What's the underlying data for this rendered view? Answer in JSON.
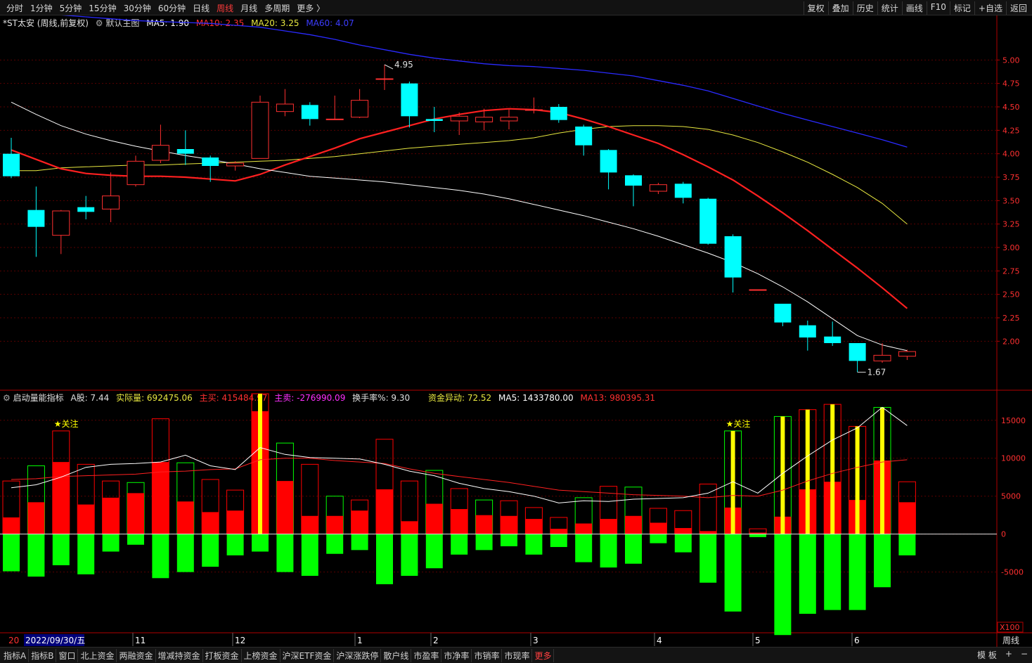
{
  "toolbar": {
    "periods": [
      "分时",
      "1分钟",
      "5分钟",
      "15分钟",
      "30分钟",
      "60分钟",
      "日线",
      "周线",
      "月线",
      "多周期",
      "更多 〉"
    ],
    "active_period": "周线",
    "tools": [
      "复权",
      "叠加",
      "历史",
      "统计",
      "画线",
      "F10",
      "标记",
      "+自选",
      "返回"
    ]
  },
  "main_header": {
    "stock": "*ST太安 (周线,前复权)",
    "template": "默认主图",
    "ma5": "MA5: 1.90",
    "ma10": "MA10: 2.35",
    "ma20": "MA20: 3.25",
    "ma60": "MA60: 4.07"
  },
  "sub_header": {
    "name": "启动量能指标",
    "a": "A股: 7.44",
    "actual": "实际量: 692475.06",
    "buy": "主买: 415484.97",
    "sell": "主卖: -276990.09",
    "turnover": "换手率%: 9.30",
    "fund": "资金异动: 72.52",
    "ma5": "MA5: 1433780.00",
    "ma13": "MA13: 980395.31"
  },
  "colors": {
    "up": "#ff3030",
    "down": "#00ffff",
    "ma5": "#ffffff",
    "ma10": "#ff2020",
    "ma20": "#e8e840",
    "ma60": "#2a2aff",
    "buy": "#ff0000",
    "sell": "#00ff00",
    "hot": "#ffff00",
    "frame": "#b00000"
  },
  "annotations": {
    "high": "4.95",
    "low": "1.67",
    "star1": "★关注",
    "star2": "★关注",
    "multiplier": "X100"
  },
  "x_axis_labels": [
    "2022/09/30/五",
    "11",
    "12",
    "1",
    "2",
    "3",
    "4",
    "5",
    "6"
  ],
  "x_axis_lead": "20",
  "period_label": "周线",
  "chart_data": [
    {
      "type": "candlestick",
      "title": "*ST太安 (周线,前复权)",
      "ylim": [
        1.5,
        5.4
      ],
      "y_ticks": [
        "5.00",
        "4.75",
        "4.50",
        "4.25",
        "4.00",
        "3.75",
        "3.50",
        "3.25",
        "3.00",
        "2.75",
        "2.50",
        "2.25",
        "2.00"
      ],
      "candles": [
        {
          "o": 4.0,
          "c": 3.76,
          "h": 4.17,
          "l": 3.74
        },
        {
          "o": 3.4,
          "c": 3.22,
          "h": 3.65,
          "l": 2.9
        },
        {
          "o": 3.13,
          "c": 3.39,
          "h": 3.4,
          "l": 2.93
        },
        {
          "o": 3.43,
          "c": 3.38,
          "h": 3.55,
          "l": 3.3
        },
        {
          "o": 3.41,
          "c": 3.55,
          "h": 3.8,
          "l": 3.27
        },
        {
          "o": 3.67,
          "c": 3.92,
          "h": 3.98,
          "l": 3.65
        },
        {
          "o": 3.93,
          "c": 4.09,
          "h": 4.31,
          "l": 3.9
        },
        {
          "o": 4.05,
          "c": 4.0,
          "h": 4.25,
          "l": 3.88
        },
        {
          "o": 3.96,
          "c": 3.87,
          "h": 3.98,
          "l": 3.7
        },
        {
          "o": 3.87,
          "c": 3.9,
          "h": 3.92,
          "l": 3.82
        },
        {
          "o": 3.95,
          "c": 4.55,
          "h": 4.62,
          "l": 3.95
        },
        {
          "o": 4.45,
          "c": 4.53,
          "h": 4.69,
          "l": 4.4
        },
        {
          "o": 4.52,
          "c": 4.37,
          "h": 4.55,
          "l": 4.3
        },
        {
          "o": 4.37,
          "c": 4.37,
          "h": 4.62,
          "l": 4.37
        },
        {
          "o": 4.39,
          "c": 4.57,
          "h": 4.69,
          "l": 4.38
        },
        {
          "o": 4.8,
          "c": 4.8,
          "h": 4.95,
          "l": 4.68
        },
        {
          "o": 4.75,
          "c": 4.4,
          "h": 4.77,
          "l": 4.28
        },
        {
          "o": 4.37,
          "c": 4.35,
          "h": 4.5,
          "l": 4.23
        },
        {
          "o": 4.35,
          "c": 4.4,
          "h": 4.44,
          "l": 4.2
        },
        {
          "o": 4.34,
          "c": 4.39,
          "h": 4.48,
          "l": 4.25
        },
        {
          "o": 4.35,
          "c": 4.39,
          "h": 4.47,
          "l": 4.26
        },
        {
          "o": 4.47,
          "c": 4.47,
          "h": 4.6,
          "l": 4.43
        },
        {
          "o": 4.5,
          "c": 4.36,
          "h": 4.53,
          "l": 4.33
        },
        {
          "o": 4.29,
          "c": 4.09,
          "h": 4.31,
          "l": 3.98
        },
        {
          "o": 4.04,
          "c": 3.8,
          "h": 4.05,
          "l": 3.62
        },
        {
          "o": 3.77,
          "c": 3.66,
          "h": 3.78,
          "l": 3.44
        },
        {
          "o": 3.6,
          "c": 3.67,
          "h": 3.69,
          "l": 3.57
        },
        {
          "o": 3.68,
          "c": 3.53,
          "h": 3.7,
          "l": 3.47
        },
        {
          "o": 3.52,
          "c": 3.04,
          "h": 3.53,
          "l": 3.03
        },
        {
          "o": 3.12,
          "c": 2.68,
          "h": 3.14,
          "l": 2.52
        },
        {
          "o": 2.55,
          "c": 2.55,
          "h": 2.55,
          "l": 2.55
        },
        {
          "o": 2.4,
          "c": 2.2,
          "h": 2.4,
          "l": 2.16
        },
        {
          "o": 2.17,
          "c": 2.04,
          "h": 2.22,
          "l": 1.9
        },
        {
          "o": 2.05,
          "c": 1.98,
          "h": 2.21,
          "l": 1.95
        },
        {
          "o": 1.98,
          "c": 1.79,
          "h": 1.98,
          "l": 1.67
        },
        {
          "o": 1.79,
          "c": 1.85,
          "h": 1.98,
          "l": 1.77
        },
        {
          "o": 1.84,
          "c": 1.89,
          "h": 1.91,
          "l": 1.8
        }
      ],
      "ma5": [
        4.55,
        4.42,
        4.3,
        4.21,
        4.14,
        4.08,
        4.03,
        3.98,
        3.94,
        3.89,
        3.84,
        3.8,
        3.76,
        3.74,
        3.72,
        3.7,
        3.67,
        3.64,
        3.61,
        3.57,
        3.52,
        3.46,
        3.4,
        3.34,
        3.27,
        3.2,
        3.12,
        3.03,
        2.94,
        2.84,
        2.72,
        2.58,
        2.42,
        2.24,
        2.06,
        1.96,
        1.9
      ],
      "ma10": [
        4.04,
        3.94,
        3.84,
        3.79,
        3.77,
        3.76,
        3.76,
        3.75,
        3.73,
        3.71,
        3.78,
        3.88,
        3.97,
        4.06,
        4.16,
        4.23,
        4.3,
        4.37,
        4.42,
        4.46,
        4.48,
        4.47,
        4.44,
        4.37,
        4.29,
        4.2,
        4.11,
        3.99,
        3.86,
        3.72,
        3.55,
        3.37,
        3.18,
        2.98,
        2.78,
        2.57,
        2.35
      ],
      "ma20": [
        3.82,
        3.82,
        3.85,
        3.86,
        3.87,
        3.88,
        3.88,
        3.89,
        3.9,
        3.91,
        3.92,
        3.93,
        3.95,
        3.97,
        4.0,
        4.03,
        4.06,
        4.08,
        4.1,
        4.12,
        4.14,
        4.17,
        4.22,
        4.26,
        4.29,
        4.3,
        4.3,
        4.29,
        4.26,
        4.2,
        4.12,
        4.02,
        3.91,
        3.78,
        3.64,
        3.47,
        3.25
      ],
      "ma60": [
        5.52,
        5.5,
        5.48,
        5.46,
        5.44,
        5.42,
        5.41,
        5.4,
        5.39,
        5.37,
        5.35,
        5.31,
        5.27,
        5.22,
        5.16,
        5.11,
        5.06,
        5.02,
        4.99,
        4.96,
        4.94,
        4.93,
        4.91,
        4.89,
        4.86,
        4.83,
        4.78,
        4.73,
        4.67,
        4.59,
        4.51,
        4.43,
        4.36,
        4.29,
        4.22,
        4.15,
        4.07
      ]
    },
    {
      "type": "bar",
      "title": "启动量能指标",
      "ylim": [
        -13000,
        18500
      ],
      "y_ticks": [
        "15000",
        "10000",
        "5000",
        "0",
        "-5000"
      ],
      "series": [
        {
          "name": "实际量",
          "values": [
            7000,
            9000,
            13600,
            9200,
            7000,
            6800,
            15200,
            9400,
            7200,
            5800,
            18500,
            12000,
            9200,
            5000,
            4500,
            12500,
            7000,
            8400,
            6000,
            4500,
            4400,
            3500,
            2200,
            4800,
            6300,
            6200,
            3400,
            3100,
            6600,
            13600,
            700,
            15500,
            16400,
            17100,
            14200,
            16700,
            6900
          ]
        },
        {
          "name": "主买",
          "values": [
            2200,
            4200,
            9500,
            3900,
            4800,
            5400,
            9500,
            4300,
            2900,
            3100,
            16200,
            7000,
            2400,
            2400,
            3100,
            5900,
            1700,
            4000,
            3300,
            2500,
            2400,
            2000,
            700,
            1400,
            2000,
            2400,
            1500,
            800,
            400,
            3500,
            200,
            2300,
            5900,
            6900,
            4500,
            9700,
            4200
          ]
        },
        {
          "name": "主卖",
          "values": [
            -4900,
            -5600,
            -4100,
            -5300,
            -2300,
            -1400,
            -5800,
            -5000,
            -4300,
            -2800,
            -2300,
            -5000,
            -5500,
            -2600,
            -2100,
            -6600,
            -5500,
            -4500,
            -2700,
            -2100,
            -1600,
            -2700,
            -1700,
            -3700,
            -4400,
            -3900,
            -1200,
            -2400,
            -6400,
            -10200,
            -400,
            -13300,
            -10500,
            -10000,
            -10000,
            -7000,
            -2800
          ]
        },
        {
          "name": "MA5",
          "values": [
            6100,
            6500,
            7500,
            8800,
            9200,
            9300,
            9500,
            10400,
            9000,
            8500,
            11400,
            10500,
            10100,
            10000,
            9900,
            9200,
            8300,
            7700,
            6700,
            6000,
            5600,
            5000,
            4100,
            4400,
            4300,
            4600,
            4700,
            4800,
            5400,
            6900,
            5400,
            8000,
            10300,
            12400,
            14000,
            16700,
            14300
          ]
        },
        {
          "name": "MA13",
          "values": [
            7200,
            7300,
            7600,
            7700,
            7800,
            7900,
            8200,
            8300,
            8500,
            8600,
            9800,
            10000,
            10000,
            9700,
            9500,
            9300,
            8600,
            8000,
            7600,
            7200,
            6800,
            6300,
            5800,
            5600,
            5400,
            5200,
            5100,
            5000,
            4800,
            5100,
            5000,
            5800,
            7000,
            8000,
            8800,
            9500,
            9800
          ]
        }
      ],
      "hot_bars": [
        10,
        29,
        31,
        32,
        33,
        34,
        35
      ],
      "star_bars": [
        2,
        29
      ]
    }
  ]
}
